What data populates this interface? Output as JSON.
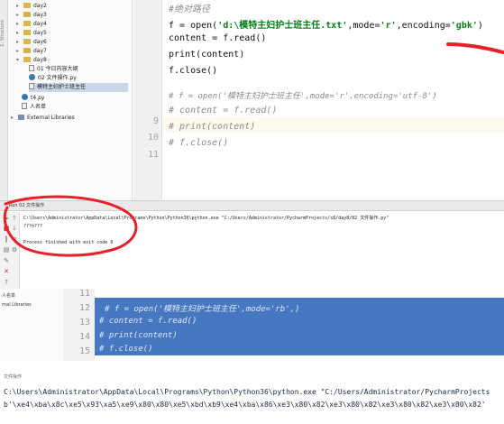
{
  "side_strip": {
    "label": "1: Structure"
  },
  "project_tree": {
    "items": [
      {
        "label": "day2",
        "kind": "folder"
      },
      {
        "label": "day3",
        "kind": "folder"
      },
      {
        "label": "day4",
        "kind": "folder"
      },
      {
        "label": "day5",
        "kind": "folder"
      },
      {
        "label": "day6",
        "kind": "folder"
      },
      {
        "label": "day7",
        "kind": "folder"
      },
      {
        "label": "day8",
        "kind": "folder"
      },
      {
        "label": "01 今日内容大纲",
        "kind": "file"
      },
      {
        "label": "02 文件操作.py",
        "kind": "py"
      },
      {
        "label": "模特主妇护士班主任",
        "kind": "file"
      },
      {
        "label": "t4.py",
        "kind": "py"
      },
      {
        "label": "人名单",
        "kind": "file"
      },
      {
        "label": "External Libraries",
        "kind": "lib"
      }
    ]
  },
  "editor_top": {
    "line_numbers": [
      "",
      "",
      "",
      "",
      "",
      "",
      "",
      "",
      "9",
      "10",
      "11"
    ],
    "lines": [
      {
        "text": "#绝对路径",
        "type": "comment"
      },
      {
        "pre": "f = open(",
        "s1": "'d:\\模特主妇护士班主任.txt'",
        "mid1": ",mode=",
        "s2": "'r'",
        "mid2": ",encoding=",
        "s3": "'gbk'",
        "post": ")",
        "type": "code"
      },
      {
        "text": "content = f.read()",
        "type": "plain"
      },
      {
        "text": "print(content)",
        "type": "plain"
      },
      {
        "text": "f.close()",
        "type": "plain"
      },
      {
        "text": "",
        "type": "plain"
      },
      {
        "text": "# f = open('模特主妇护士班主任',mode='r',encoding='utf-8')",
        "type": "comment"
      },
      {
        "text": "# content = f.read()",
        "type": "comment"
      },
      {
        "text": "# print(content)",
        "type": "comment"
      },
      {
        "text": "# f.close()",
        "type": "comment"
      },
      {
        "text": "",
        "type": "plain"
      }
    ]
  },
  "run_panel": {
    "header": "Run 02 文件操作",
    "command": "C:\\Users\\Administrator\\AppData\\Local\\Programs\\Python\\Python36\\python.exe \"C:/Users/Administrator/PycharmProjects/s8/day8/02 文件操作.py\"",
    "output": "???ó???",
    "exit": "Process finished with exit code 0"
  },
  "bottom_tree": {
    "items": [
      "人名单",
      "rnal Libraries"
    ]
  },
  "editor_bottom": {
    "line_numbers": [
      "11",
      "12",
      "13",
      "14",
      "15"
    ],
    "lines": [
      "# f = open('模特主妇护士班主任',mode='rb',)",
      "# content = f.read()",
      "# print(content)",
      "# f.close()"
    ]
  },
  "console_bottom": {
    "header": "文件操作",
    "line1": "C:\\Users\\Administrator\\AppData\\Local\\Programs\\Python\\Python36\\python.exe \"C:/Users/Administrator/PycharmProjects",
    "line2": "b'\\xe4\\xba\\x8c\\xe5\\x93\\xa5\\xe9\\x80\\x80\\xe5\\xbd\\xb9\\xe4\\xba\\x86\\xe3\\x80\\x82\\xe3\\x80\\x82\\xe3\\x80\\x82\\xe3\\x80\\x82'"
  },
  "colors": {
    "annotation": "#e8202a",
    "selection": "#2e64b8",
    "string": "#067d17",
    "comment": "#8c8c8c"
  }
}
